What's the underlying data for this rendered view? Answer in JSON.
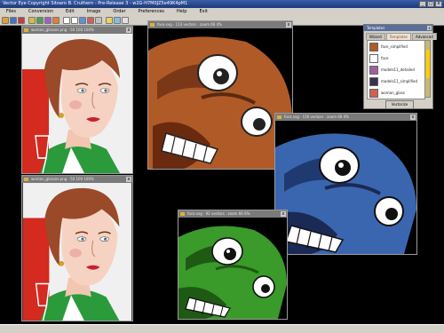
{
  "app": {
    "title": "Vector Eye Copyright Sitoaro B. Cruthern - Pre-Release 3 - w2G-H7M0JZ5e49K4pM1",
    "window_controls": [
      "_",
      "□",
      "x"
    ]
  },
  "menu": [
    "Files",
    "Conversion",
    "Edit",
    "Image",
    "Order",
    "Preferences",
    "Help",
    "Exit"
  ],
  "windows": {
    "woman_top": {
      "title": "woman_glasses.png · 50 100 100%"
    },
    "woman_bottom": {
      "title": "woman_glasses.png · 50 100 100%"
    },
    "face_orange": {
      "title": "face.svg · 113 vectors · zoom 66 4%"
    },
    "face_blue": {
      "title": "face.svg · 116 vectors · zoom 66 4%"
    },
    "face_green": {
      "title": "face.svg · 92 vectors · zoom 66 6%"
    }
  },
  "panel": {
    "title": "Templates",
    "tabs": [
      "Wizard",
      "Templates",
      "Advanced"
    ],
    "active_tab": "Templates",
    "items": [
      {
        "label": "face_simplified"
      },
      {
        "label": "face"
      },
      {
        "label": "models11_detailed"
      },
      {
        "label": "models11_simplified"
      },
      {
        "label": "woman_glass"
      }
    ],
    "button": "Vectorize"
  },
  "colors": {
    "face_orange": "#b05a28",
    "face_blue": "#3a66b0",
    "face_green": "#3a9a2a",
    "accent": "#ffcc00"
  }
}
